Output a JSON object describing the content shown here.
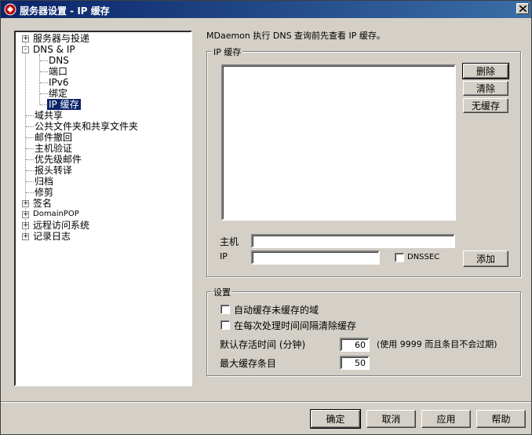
{
  "window": {
    "title": "服务器设置 - IP 缓存",
    "close_glyph": "X"
  },
  "tree": {
    "items": [
      {
        "label": "服务器与投递",
        "expander": "+"
      },
      {
        "label": "DNS & IP",
        "expander": "-"
      },
      {
        "label": "DNS"
      },
      {
        "label": "端口"
      },
      {
        "label": "IPv6"
      },
      {
        "label": "绑定"
      },
      {
        "label": "IP 缓存"
      },
      {
        "label": "域共享"
      },
      {
        "label": "公共文件夹和共享文件夹"
      },
      {
        "label": "邮件撤回"
      },
      {
        "label": "主机验证"
      },
      {
        "label": "优先级邮件"
      },
      {
        "label": "报头转译"
      },
      {
        "label": "归档"
      },
      {
        "label": "修剪"
      },
      {
        "label": "签名",
        "expander": "+"
      },
      {
        "label": "DomainPOP",
        "expander": "+"
      },
      {
        "label": "远程访问系统",
        "expander": "+"
      },
      {
        "label": "记录日志",
        "expander": "+"
      }
    ],
    "selected": "IP 缓存"
  },
  "main": {
    "description": "MDaemon 执行 DNS 查询前先查看 IP 缓存。",
    "ip_cache_group": {
      "legend": "IP 缓存",
      "entries": [],
      "delete_label": "删除",
      "clear_label": "清除",
      "no_cache_label": "无缓存",
      "host_label": "主机",
      "host_value": "",
      "ip_label": "IP",
      "ip_value": "",
      "dnssec_label": "DNSSEC",
      "dnssec_checked": false,
      "add_label": "添加"
    },
    "settings_group": {
      "legend": "设置",
      "auto_cache_label": "自动缓存未缓存的域",
      "auto_cache_checked": false,
      "clear_interval_label": "在每次处理时间间隔清除缓存",
      "clear_interval_checked": false,
      "ttl_label": "默认存活时间 (分钟)",
      "ttl_value": "60",
      "ttl_note": "(使用 9999 而且条目不会过期)",
      "max_entries_label": "最大缓存条目",
      "max_entries_value": "50"
    }
  },
  "footer": {
    "ok_label": "确定",
    "cancel_label": "取消",
    "apply_label": "应用",
    "help_label": "帮助"
  },
  "colors": {
    "titlebar": "#0a246a",
    "face": "#d4d0c8",
    "selection": "#0a246a"
  }
}
